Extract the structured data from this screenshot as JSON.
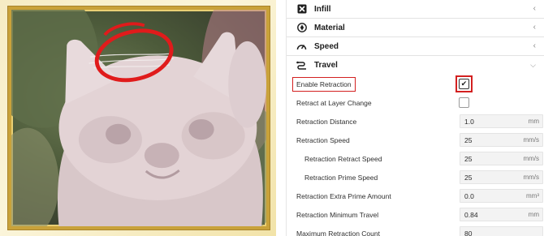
{
  "panel": {
    "categories": [
      {
        "label": "Infill",
        "icon": "infill-icon"
      },
      {
        "label": "Material",
        "icon": "material-icon"
      },
      {
        "label": "Speed",
        "icon": "speed-icon"
      },
      {
        "label": "Travel",
        "icon": "travel-icon"
      }
    ],
    "settings": {
      "enable_retraction": {
        "label": "Enable Retraction",
        "checked": true,
        "check_glyph": "✔"
      },
      "retract_layer_change": {
        "label": "Retract at Layer Change",
        "checked": false
      },
      "retraction_distance": {
        "label": "Retraction Distance",
        "value": "1.0",
        "unit": "mm"
      },
      "retraction_speed": {
        "label": "Retraction Speed",
        "value": "25",
        "unit": "mm/s"
      },
      "retract_speed": {
        "label": "Retraction Retract Speed",
        "value": "25",
        "unit": "mm/s"
      },
      "prime_speed": {
        "label": "Retraction Prime Speed",
        "value": "25",
        "unit": "mm/s"
      },
      "extra_prime": {
        "label": "Retraction Extra Prime Amount",
        "value": "0.0",
        "unit": "mm³"
      },
      "min_travel": {
        "label": "Retraction Minimum Travel",
        "value": "0.84",
        "unit": "mm"
      },
      "max_count": {
        "label": "Maximum Retraction Count",
        "value": "80",
        "unit": ""
      }
    }
  },
  "colors": {
    "highlight": "#d32020",
    "frame_gold": "#c9a23a",
    "annotation_red": "#e01b1b"
  }
}
